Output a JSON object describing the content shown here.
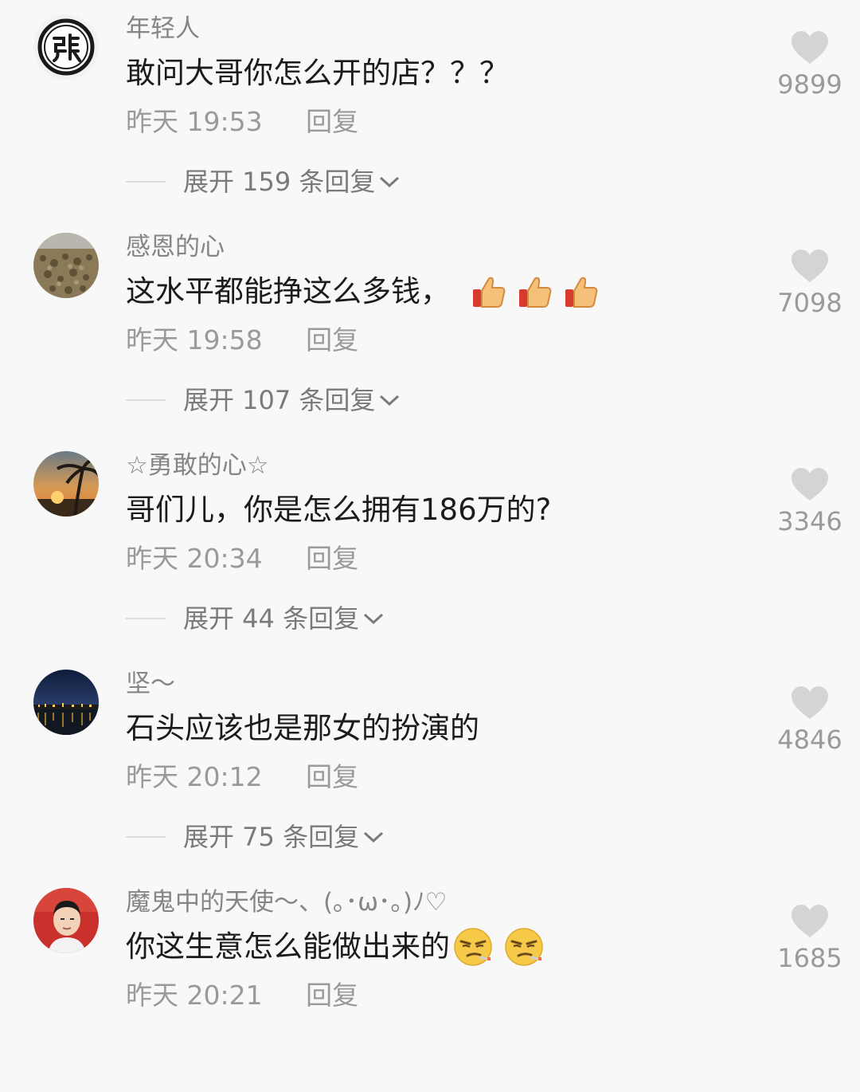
{
  "comments": [
    {
      "username": "年轻人",
      "text": "敢问大哥你怎么开的店？？？",
      "time": "昨天 19:53",
      "reply_label": "回复",
      "expand_label": "展开 159 条回复",
      "likes": "9899",
      "avatar": "zhang-seal-avatar",
      "emojis": []
    },
    {
      "username": "感恩的心",
      "text": "这水平都能挣这么多钱，",
      "time": "昨天 19:58",
      "reply_label": "回复",
      "expand_label": "展开 107 条回复",
      "likes": "7098",
      "avatar": "grain-photo-avatar",
      "emojis": [
        "thumbs-up-icon",
        "thumbs-up-icon",
        "thumbs-up-icon"
      ]
    },
    {
      "username": "☆勇敢的心☆",
      "text": "哥们儿，你是怎么拥有186万的?",
      "time": "昨天 20:34",
      "reply_label": "回复",
      "expand_label": "展开 44 条回复",
      "likes": "3346",
      "avatar": "palm-sunset-avatar",
      "emojis": []
    },
    {
      "username": "坚～",
      "text": "石头应该也是那女的扮演的",
      "time": "昨天 20:12",
      "reply_label": "回复",
      "expand_label": "展开 75 条回复",
      "likes": "4846",
      "avatar": "night-city-avatar",
      "emojis": []
    },
    {
      "username": "魔鬼中的天使～、(｡･ω･｡)ﾉ♡",
      "text": "你这生意怎么能做出来的",
      "time": "昨天 20:21",
      "reply_label": "回复",
      "likes": "1685",
      "avatar": "man-portrait-avatar",
      "emojis": [
        "smirk-face-icon",
        "smirk-face-icon"
      ]
    }
  ]
}
